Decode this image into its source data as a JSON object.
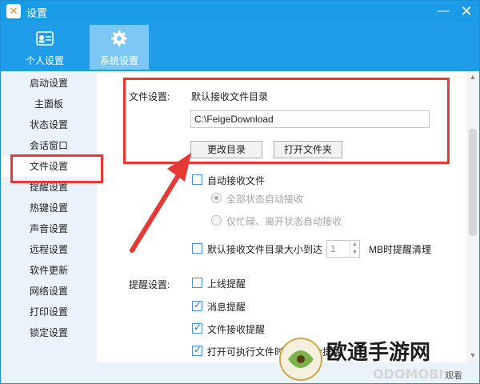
{
  "window": {
    "title": "设置",
    "app_icon": "feige-logo-icon"
  },
  "header": {
    "tabs": [
      {
        "label": "个人设置",
        "icon": "user-card-icon",
        "active": false
      },
      {
        "label": "系统设置",
        "icon": "gear-icon",
        "active": true
      }
    ]
  },
  "sidebar": {
    "items": [
      {
        "label": "启动设置"
      },
      {
        "label": "主面板"
      },
      {
        "label": "状态设置"
      },
      {
        "label": "会话窗口"
      },
      {
        "label": "文件设置",
        "active": true
      },
      {
        "label": "提醒设置"
      },
      {
        "label": "热键设置"
      },
      {
        "label": "声音设置"
      },
      {
        "label": "远程设置"
      },
      {
        "label": "软件更新"
      },
      {
        "label": "网络设置"
      },
      {
        "label": "打印设置"
      },
      {
        "label": "锁定设置"
      }
    ]
  },
  "file_settings": {
    "section_label": "文件设置:",
    "dir_label": "默认接收文件目录",
    "dir_value": "C:\\FeigeDownload",
    "change_dir_button": "更改目录",
    "open_folder_button": "打开文件夹",
    "auto_receive": {
      "label": "自动接收文件",
      "checked": false
    },
    "receive_all_states": {
      "label": "全部状态自动接收",
      "selected": true,
      "enabled": false
    },
    "receive_busy_away": {
      "label": "仅忙碌、离开状态自动接收",
      "selected": false,
      "enabled": false
    },
    "size_limit": {
      "prefix": "默认接收文件目录大小到达",
      "value": "1",
      "suffix": "MB时提醒清理",
      "checked": false
    }
  },
  "reminder_settings": {
    "section_label": "提醒设置:",
    "items": [
      {
        "label": "上线提醒",
        "checked": false
      },
      {
        "label": "消息提醒",
        "checked": true
      },
      {
        "label": "文件接收提醒",
        "checked": true
      },
      {
        "label": "打开可执行文件时进行安全提醒",
        "checked": true
      }
    ]
  },
  "watermark": {
    "text": "欧通手游网",
    "subtext": "ODOMOBI",
    "label": "观看"
  },
  "colors": {
    "title_bar": "#1a9be6",
    "header": "#1f9de9",
    "active_tab": "#7cc7f4",
    "sidebar": "#eaf3fc",
    "highlight": "#e53935"
  }
}
